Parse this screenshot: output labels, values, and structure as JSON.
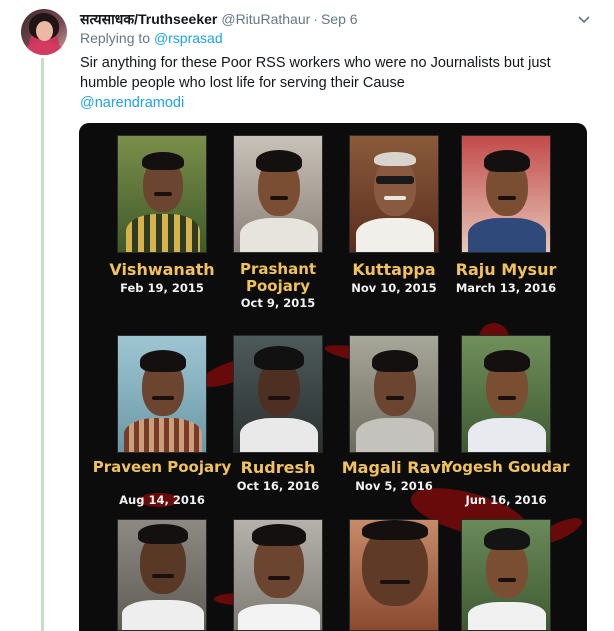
{
  "tweet": {
    "display_name": "सत्यसाधक/Truthseeker",
    "handle": "@RituRathaur",
    "separator": "·",
    "time": "Sep 6",
    "replying_prefix": "Replying to",
    "replying_to": "@rsprasad",
    "body": "Sir anything for these Poor RSS workers who were no Journalists but just humble people who lost life for serving their Cause",
    "mention": "@narendramodi",
    "menu_icon": "chevron-down-icon"
  },
  "image": {
    "people": [
      {
        "name": "Vishwanath",
        "date": "Feb 19, 2015"
      },
      {
        "name": "Prashant Poojary",
        "date": "Oct 9, 2015"
      },
      {
        "name": "Kuttappa",
        "date": "Nov 10, 2015"
      },
      {
        "name": "Raju Mysur",
        "date": "March 13, 2016"
      },
      {
        "name": "Praveen Poojary",
        "date": "Aug 14, 2016"
      },
      {
        "name": "Rudresh",
        "date": "Oct 16, 2016"
      },
      {
        "name": "Magali Ravi",
        "date": "Nov 5, 2016"
      },
      {
        "name": "Yogesh Goudar",
        "date": "Jun 16, 2016"
      }
    ],
    "colors": {
      "name_text": "#f2c25a",
      "date_text": "#f2f2f2",
      "background": "#0c0c0c",
      "blood": "#7a0b0b"
    }
  }
}
